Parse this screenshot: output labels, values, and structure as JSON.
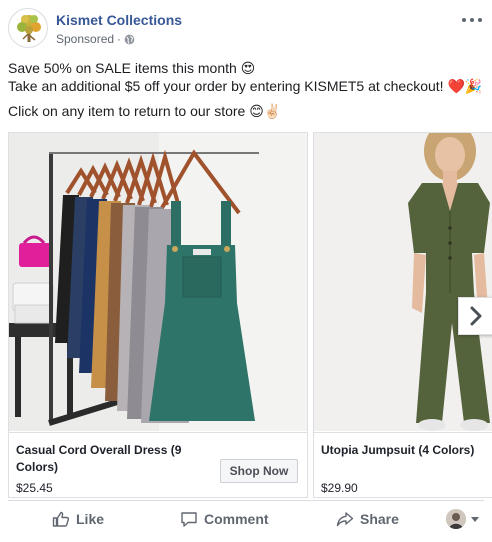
{
  "post": {
    "page_name": "Kismet Collections",
    "sponsored": "Sponsored",
    "separator": "·",
    "text_lines": [
      "Save 50% on SALE items this month 😍",
      "Take an additional $5 off your order by entering KISMET5 at checkout! ❤️🎉",
      "Click on any item to return to our store 😊✌🏻"
    ]
  },
  "cards": [
    {
      "title": "Casual Cord Overall Dress (9 Colors)",
      "price": "$25.45",
      "button": "Shop Now"
    },
    {
      "title": "Utopia Jumpsuit (4 Colors)",
      "price": "$29.90"
    }
  ],
  "actions": {
    "like": "Like",
    "comment": "Comment",
    "share": "Share"
  },
  "colors": {
    "link": "#385898",
    "meta": "#616770",
    "action": "#606770",
    "border": "#dddfe2"
  },
  "icons": [
    "tree-logo-icon",
    "globe-icon",
    "more-dots-icon",
    "chevron-right-icon",
    "like-thumb-icon",
    "comment-bubble-icon",
    "share-arrow-icon",
    "reaction-avatar-icon",
    "caret-down-icon"
  ]
}
